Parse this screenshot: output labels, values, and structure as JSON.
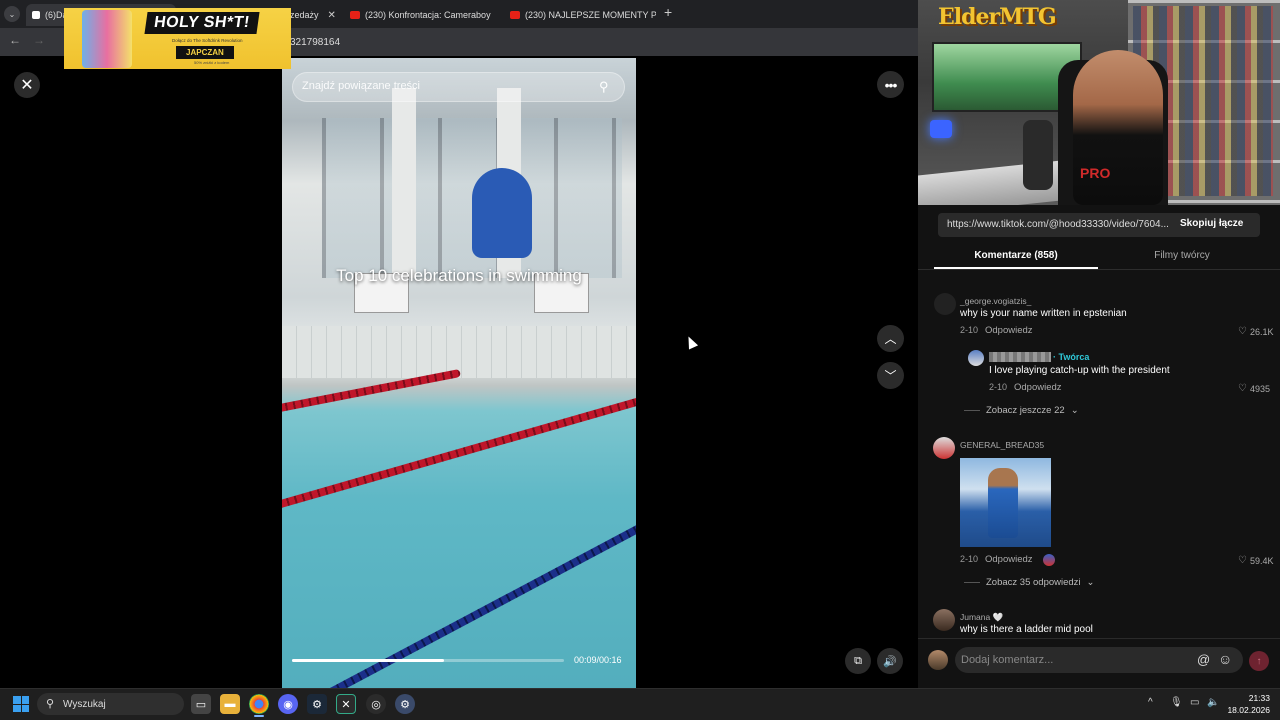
{
  "browser": {
    "tabs": [
      {
        "label": "(6)DawidKam... | Śmieh..."
      },
      {
        "label": "przedaży"
      },
      {
        "label": "(230) Konfrontacja: Cameraboy"
      },
      {
        "label": "(230) NAJLEPSZE MOMENTY PL"
      }
    ],
    "url_fragment": "321798164"
  },
  "ad": {
    "title": "HOLY SH*T!",
    "subtitle": "Dołącz do The Softdrink Revolution",
    "brand": "JAPCZAN",
    "footer": "50% zniżki z kodem"
  },
  "video": {
    "search_placeholder": "Znajdź powiązane treści",
    "caption": "Top 10 celebrations in swimming",
    "timecode": "00:09/00:16",
    "progress_fraction": 0.56
  },
  "webcam": {
    "logo": "ElderMTG",
    "shirt_text": "PRO"
  },
  "panel": {
    "share_url": "https://www.tiktok.com/@hood33330/video/7604...",
    "copy_label": "Skopiuj łącze",
    "tab_comments": "Komentarze (858)",
    "tab_creator": "Filmy twórcy"
  },
  "comments": [
    {
      "user": "_george.vogiatzis_",
      "text": "why is your name written in epstenian",
      "date": "2-10",
      "reply_label": "Odpowiedz",
      "likes": "26.1K"
    },
    {
      "creator_label": "· Twórca",
      "text": "I love playing catch-up with the president",
      "date": "2-10",
      "reply_label": "Odpowiedz",
      "likes": "4935"
    },
    {
      "user": "GENERAL_BREAD35",
      "date": "2-10",
      "reply_label": "Odpowiedz",
      "likes": "59.4K"
    },
    {
      "user": "Jumana 🤍",
      "text": "why is there a ladder mid pool"
    }
  ],
  "more_replies": [
    "Zobacz jeszcze 22",
    "Zobacz 35 odpowiedzi"
  ],
  "input": {
    "placeholder": "Dodaj komentarz..."
  },
  "taskbar": {
    "search_text": "Wyszukaj",
    "time": "21:33",
    "date": "18.02.2026"
  }
}
